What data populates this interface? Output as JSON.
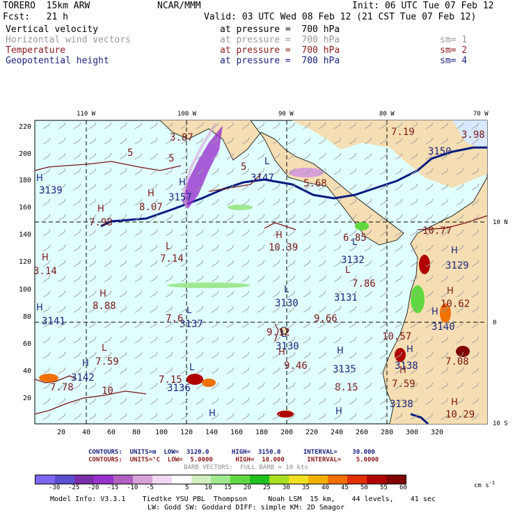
{
  "header": {
    "model": "TORERO  15km ARW",
    "org": "NCAR/MMM",
    "init": "Init: 06 UTC Tue 07 Feb 12",
    "fcst": "Fcst:   21 h",
    "valid": "Valid: 03 UTC Wed 08 Feb 12 (21 CST Tue 07 Feb 12)"
  },
  "fields": [
    {
      "name": "Vertical velocity",
      "level": "at pressure =  700 hPa",
      "sm": "",
      "color": "#000000"
    },
    {
      "name": "Horizontal wind vectors",
      "level": "at pressure =  700 hPa",
      "sm": "sm= 1",
      "color": "#9a9a9a"
    },
    {
      "name": "Temperature",
      "level": "at pressure =  700 hPa",
      "sm": "sm= 2",
      "color": "#8b1a1a"
    },
    {
      "name": "Geopotential height",
      "level": "at pressure =  700 hPa",
      "sm": "sm= 4",
      "color": "#1a237e"
    }
  ],
  "map": {
    "lon_labels": [
      "110 W",
      "100 W",
      "90 W",
      "80 W",
      "70 W"
    ],
    "lat_labels_right": [
      "10 N",
      "0",
      "10 S"
    ],
    "y_ticks": [
      "220",
      "200",
      "180",
      "160",
      "140",
      "120",
      "100",
      "80",
      "60",
      "40",
      "20"
    ],
    "x_ticks": [
      "20",
      "40",
      "60",
      "80",
      "100",
      "120",
      "140",
      "160",
      "180",
      "200",
      "220",
      "240",
      "260",
      "280",
      "300",
      "320"
    ],
    "height_labels": [
      "3150",
      "3147",
      "3157",
      "3132",
      "3129",
      "3131",
      "3130",
      "3137",
      "3130",
      "3140",
      "3138",
      "3135",
      "3136",
      "3142",
      "3138",
      "3141",
      "3139"
    ],
    "temp_labels": [
      "7.19",
      "3.98",
      "3.87",
      "5",
      "5",
      "5",
      "5.68",
      "8.07",
      "7.98",
      "6.85",
      "10.77",
      "10.39",
      "7.14",
      "7.86",
      "8.88",
      "10.62",
      "9.66",
      "7.6",
      "9.12",
      "10.57",
      "7.59",
      "9.46",
      "7.08",
      "8.15",
      "10",
      "7.78",
      "7.59",
      "10.29",
      "7.15",
      "3.14"
    ]
  },
  "contours": {
    "line1": "CONTOURS:  UNITS=m  LOW=  3120.0      HIGH=  3150.0      INTERVAL=    30.000",
    "line2": "CONTOURS:  UNITS=°C  LOW=  5.0000      HIGH=  10.000      INTERVAL=    5.0000",
    "barb": "BARB VECTORS:  FULL BARB = 10 kts"
  },
  "colorbar": {
    "labels": [
      "-30",
      "-25",
      "-20",
      "-15",
      "-10",
      "-5",
      "5",
      "10",
      "15",
      "20",
      "25",
      "30",
      "35",
      "40",
      "45",
      "50",
      "55",
      "60"
    ],
    "units": "cm s",
    "units_exp": "-1",
    "colors": [
      "#7b68ee",
      "#5a4fcf",
      "#7b2fa8",
      "#9932cc",
      "#b060c0",
      "#d8a0d8",
      "#f0d8f0",
      "#ffffff",
      "#d0f0c0",
      "#a0e890",
      "#60d840",
      "#20c020",
      "#a8e020",
      "#f0e020",
      "#f0b000",
      "#f07000",
      "#e03000",
      "#b00000",
      "#800000"
    ]
  },
  "footer": {
    "line1": "Model Info: V3.3.1    Tiedtke YSU PBL  Thompson     Noah LSM  15 km,    44 levels,    41 sec",
    "line2": "LW: Godd SW: Goddard DIFF: simple KM: 2D Smagor"
  }
}
